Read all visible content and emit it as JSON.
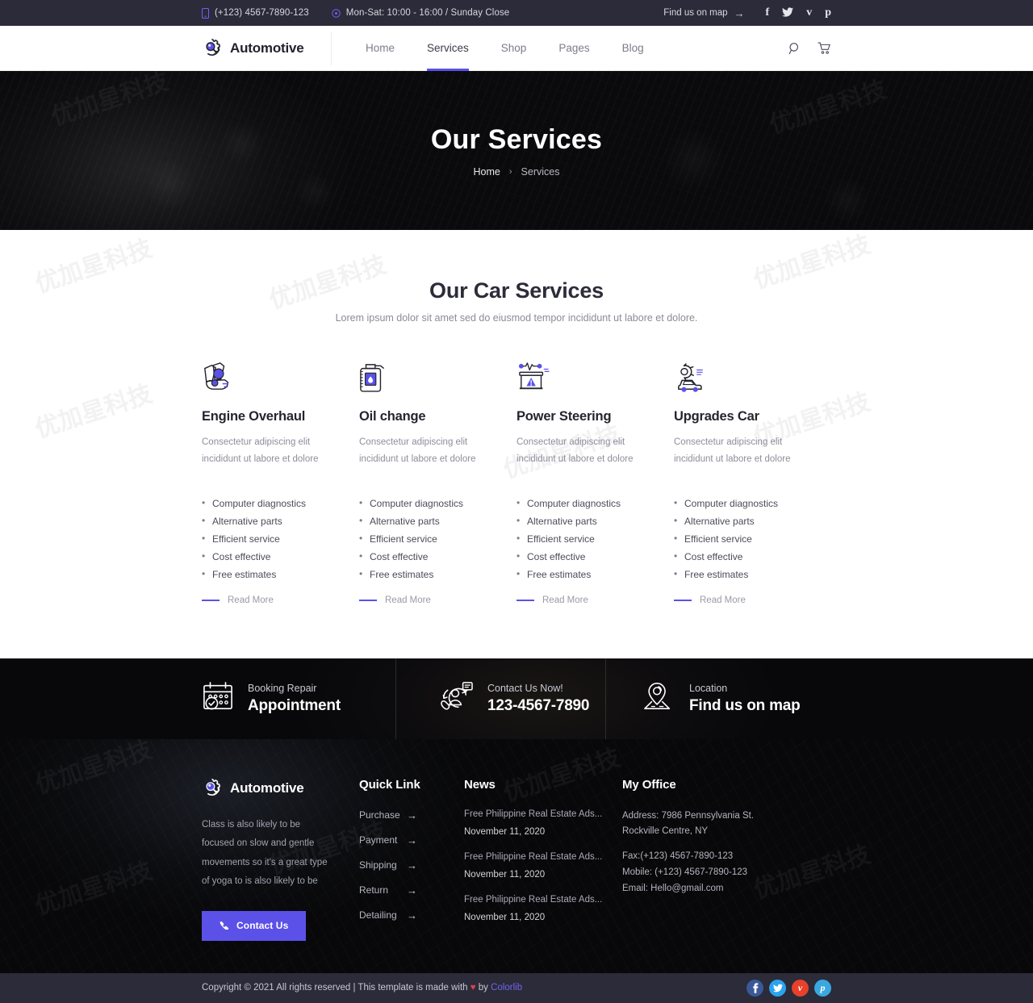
{
  "topbar": {
    "phone": "(+123) 4567-7890-123",
    "hours": "Mon-Sat: 10:00 - 16:00 / Sunday Close",
    "find_map": "Find us on map",
    "find_map_arrow": "→",
    "socials": [
      {
        "name": "facebook-icon",
        "glyph": "f"
      },
      {
        "name": "twitter-icon",
        "glyph": "🐦"
      },
      {
        "name": "vimeo-icon",
        "glyph": "v"
      },
      {
        "name": "pinterest-icon",
        "glyph": "p"
      }
    ]
  },
  "header": {
    "brand": "Automotive",
    "nav": [
      {
        "label": "Home",
        "active": false
      },
      {
        "label": "Services",
        "active": true
      },
      {
        "label": "Shop",
        "active": false
      },
      {
        "label": "Pages",
        "active": false
      },
      {
        "label": "Blog",
        "active": false
      }
    ],
    "search_icon": "search-icon",
    "cart_icon": "cart-icon"
  },
  "hero": {
    "title": "Our Services",
    "breadcrumb_home": "Home",
    "breadcrumb_sep": "›",
    "breadcrumb_current": "Services"
  },
  "services_section": {
    "title": "Our Car Services",
    "subtitle": "Lorem ipsum dolor sit amet sed do eiusmod tempor incididunt ut labore et dolore.",
    "cards": [
      {
        "icon": "engine-overhaul-icon",
        "name": "Engine Overhaul",
        "desc": "Consectetur adipiscing elit incididunt ut labore et dolore",
        "features": [
          "Computer diagnostics",
          "Alternative parts",
          "Efficient service",
          "Cost effective",
          "Free estimates"
        ],
        "read_more": "Read More"
      },
      {
        "icon": "oil-can-icon",
        "name": "Oil change",
        "desc": "Consectetur adipiscing elit incididunt ut labore et dolore",
        "features": [
          "Computer diagnostics",
          "Alternative parts",
          "Efficient service",
          "Cost effective",
          "Free estimates"
        ],
        "read_more": "Read More"
      },
      {
        "icon": "battery-icon",
        "name": "Power Steering",
        "desc": "Consectetur adipiscing elit incididunt ut labore et dolore",
        "features": [
          "Computer diagnostics",
          "Alternative parts",
          "Efficient service",
          "Cost effective",
          "Free estimates"
        ],
        "read_more": "Read More"
      },
      {
        "icon": "car-upgrade-icon",
        "name": "Upgrades Car",
        "desc": "Consectetur adipiscing elit incididunt ut labore et dolore",
        "features": [
          "Computer diagnostics",
          "Alternative parts",
          "Efficient service",
          "Cost effective",
          "Free estimates"
        ],
        "read_more": "Read More"
      }
    ]
  },
  "info_strip": [
    {
      "icon": "calendar-icon",
      "small": "Booking Repair",
      "large": "Appointment"
    },
    {
      "icon": "support-agent-icon",
      "small": "Contact Us Now!",
      "large": "123-4567-7890"
    },
    {
      "icon": "map-pin-icon",
      "small": "Location",
      "large": "Find us on map"
    }
  ],
  "footer": {
    "brand": "Automotive",
    "about": "Class is also likely to be focused on slow and gentle movements so it's a great type of yoga to is also likely to be",
    "contact_button": "Contact Us",
    "quick": {
      "title": "Quick Link",
      "items": [
        {
          "label": "Purchase",
          "arrow": "→"
        },
        {
          "label": "Payment",
          "arrow": "→"
        },
        {
          "label": "Shipping",
          "arrow": "→"
        },
        {
          "label": "Return",
          "arrow": "→"
        },
        {
          "label": "Detailing",
          "arrow": "→"
        }
      ]
    },
    "news": {
      "title": "News",
      "items": [
        {
          "title": "Free Philippine Real Estate Ads...",
          "date": "November 11, 2020"
        },
        {
          "title": "Free Philippine Real Estate Ads...",
          "date": "November 11, 2020"
        },
        {
          "title": "Free Philippine Real Estate Ads...",
          "date": "November 11, 2020"
        }
      ]
    },
    "office": {
      "title": "My Office",
      "address_line1": "Address: 7986 Pennsylvania St.",
      "address_line2": "Rockville Centre, NY",
      "fax": "Fax:(+123) 4567-7890-123",
      "mobile": "Mobile: (+123) 4567-7890-123",
      "email": "Email: Hello@gmail.com"
    }
  },
  "copyright": {
    "text_before": "Copyright © 2021 All rights reserved | This template is made with ",
    "heart": "♥",
    "text_by": " by ",
    "link": "Colorlib",
    "socials": [
      {
        "name": "facebook-icon",
        "glyph": "f",
        "color": "#3b5998"
      },
      {
        "name": "twitter-icon",
        "glyph": "t",
        "color": "#2aa3ef"
      },
      {
        "name": "vimeo-icon",
        "glyph": "v",
        "color": "#e8402a"
      },
      {
        "name": "pinterest-icon",
        "glyph": "p",
        "color": "#3aa8e0"
      }
    ]
  },
  "colors": {
    "accent": "#5b51e8",
    "dark": "#2b2b39",
    "heart": "#e0414d"
  },
  "watermark": "优加星科技"
}
